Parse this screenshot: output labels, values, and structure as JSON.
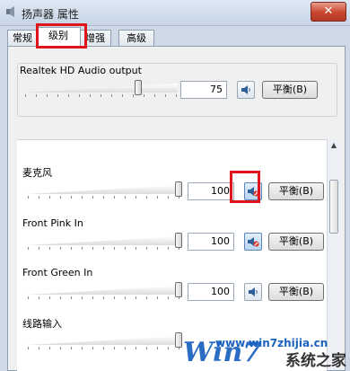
{
  "window": {
    "title": "扬声器 属性",
    "close_label": "✕"
  },
  "tabs": [
    {
      "label": "常规"
    },
    {
      "label": "级别"
    },
    {
      "label": "增强"
    },
    {
      "label": "高级"
    }
  ],
  "devices": [
    {
      "label": "Realtek HD Audio output",
      "value": "75",
      "level": 0.75,
      "muted": false,
      "button": "平衡(B)"
    },
    {
      "label": "麦克风",
      "value": "100",
      "level": 1.0,
      "muted": true,
      "button": "平衡(B)"
    },
    {
      "label": "Front Pink In",
      "value": "100",
      "level": 1.0,
      "muted": true,
      "button": "平衡(B)"
    },
    {
      "label": "Front Green In",
      "value": "100",
      "level": 1.0,
      "muted": false,
      "button": "平衡(B)"
    },
    {
      "label": "线路输入",
      "level": 1.0
    }
  ],
  "watermark": {
    "logo": "Win7",
    "site": "www.win7zhijia.cn",
    "brand": "系统之家"
  },
  "colors": {
    "highlight": "#e0141b",
    "close": "#c8462e"
  },
  "icons": {
    "speaker": "speaker-icon",
    "muted": "speaker-muted-icon"
  }
}
